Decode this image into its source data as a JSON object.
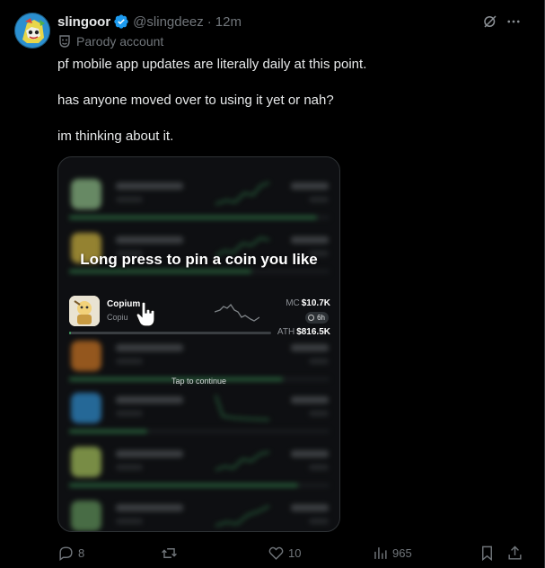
{
  "tweet": {
    "display_name": "slingoor",
    "handle": "@slingdeez",
    "separator": "·",
    "time": "12m",
    "label": "Parody account",
    "text_lines": [
      "pf mobile app updates are literally daily at this point.",
      "has anyone moved over to using it yet or nah?",
      "im thinking about it."
    ]
  },
  "media": {
    "overlay_title": "Long press to pin a coin you like",
    "tap_hint": "Tap to continue",
    "focused_coin": {
      "name": "Copium",
      "subtitle": "Copiu",
      "mc_label": "MC",
      "mc_value": "$10.7K",
      "age": "6h",
      "ath_label": "ATH",
      "ath_value": "$816.5K",
      "progress": 0.01
    },
    "blurred_rows": [
      {
        "icon_color": "#9fd39a",
        "progress": 0.95
      },
      {
        "icon_color": "#e3c84c",
        "progress": 0.7
      },
      {
        "icon_color": "#e3862e",
        "progress": 0.82
      },
      {
        "icon_color": "#3aa0e8",
        "progress": 0.3
      },
      {
        "icon_color": "#b9d86a",
        "progress": 0.88
      },
      {
        "icon_color": "#6fa66a",
        "progress": 0.6
      }
    ]
  },
  "actions": {
    "replies": "8",
    "retweets": "",
    "likes": "10",
    "views": "965"
  },
  "colors": {
    "background": "#000000",
    "text_primary": "#e7e9ea",
    "text_secondary": "#71767b",
    "verified": "#1d9bf0",
    "accent_green": "#3f9b5e"
  }
}
